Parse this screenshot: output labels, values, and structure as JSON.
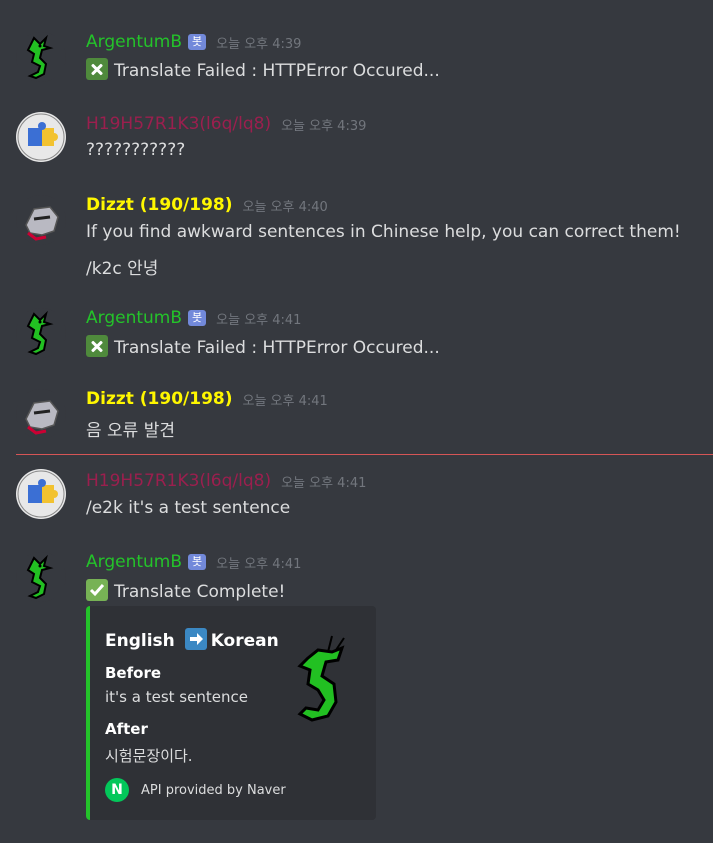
{
  "colors": {
    "bot_name": "#24c32a",
    "h19_name": "#9b1f4e",
    "dizzt_name": "#fff700",
    "divider": "#d65556",
    "embed_border": "#24c32a"
  },
  "messages": [
    {
      "user": "ArgentumB",
      "badge": "봇",
      "time": "오늘 오후 4:39",
      "lines": [
        "Translate Failed : HTTPError Occured..."
      ],
      "icon": "cross-mark-icon"
    },
    {
      "user": "H19H57R1K3(l6q/lq8)",
      "time": "오늘 오후 4:39",
      "lines": [
        "???????????"
      ]
    },
    {
      "user": "Dizzt (190/198)",
      "time": "오늘 오후 4:40",
      "lines": [
        "If you find awkward sentences in Chinese help, you can correct them!",
        "/k2c 안녕"
      ]
    },
    {
      "user": "ArgentumB",
      "badge": "봇",
      "time": "오늘 오후 4:41",
      "lines": [
        "Translate Failed : HTTPError Occured..."
      ],
      "icon": "cross-mark-icon"
    },
    {
      "user": "Dizzt (190/198)",
      "time": "오늘 오후 4:41",
      "lines": [
        "음 오류 발견"
      ]
    },
    {
      "user": "H19H57R1K3(l6q/lq8)",
      "time": "오늘 오후 4:41",
      "lines": [
        "/e2k it's a test sentence"
      ]
    },
    {
      "user": "ArgentumB",
      "badge": "봇",
      "time": "오늘 오후 4:41",
      "lines": [
        "Translate Complete!"
      ],
      "icon": "check-mark-icon"
    }
  ],
  "embed": {
    "title_from": "English",
    "title_to": "Korean",
    "fields": [
      {
        "name": "Before",
        "value": "it's a test sentence"
      },
      {
        "name": "After",
        "value": "시험문장이다."
      }
    ],
    "footer_icon": "N",
    "footer": "API provided by Naver"
  }
}
